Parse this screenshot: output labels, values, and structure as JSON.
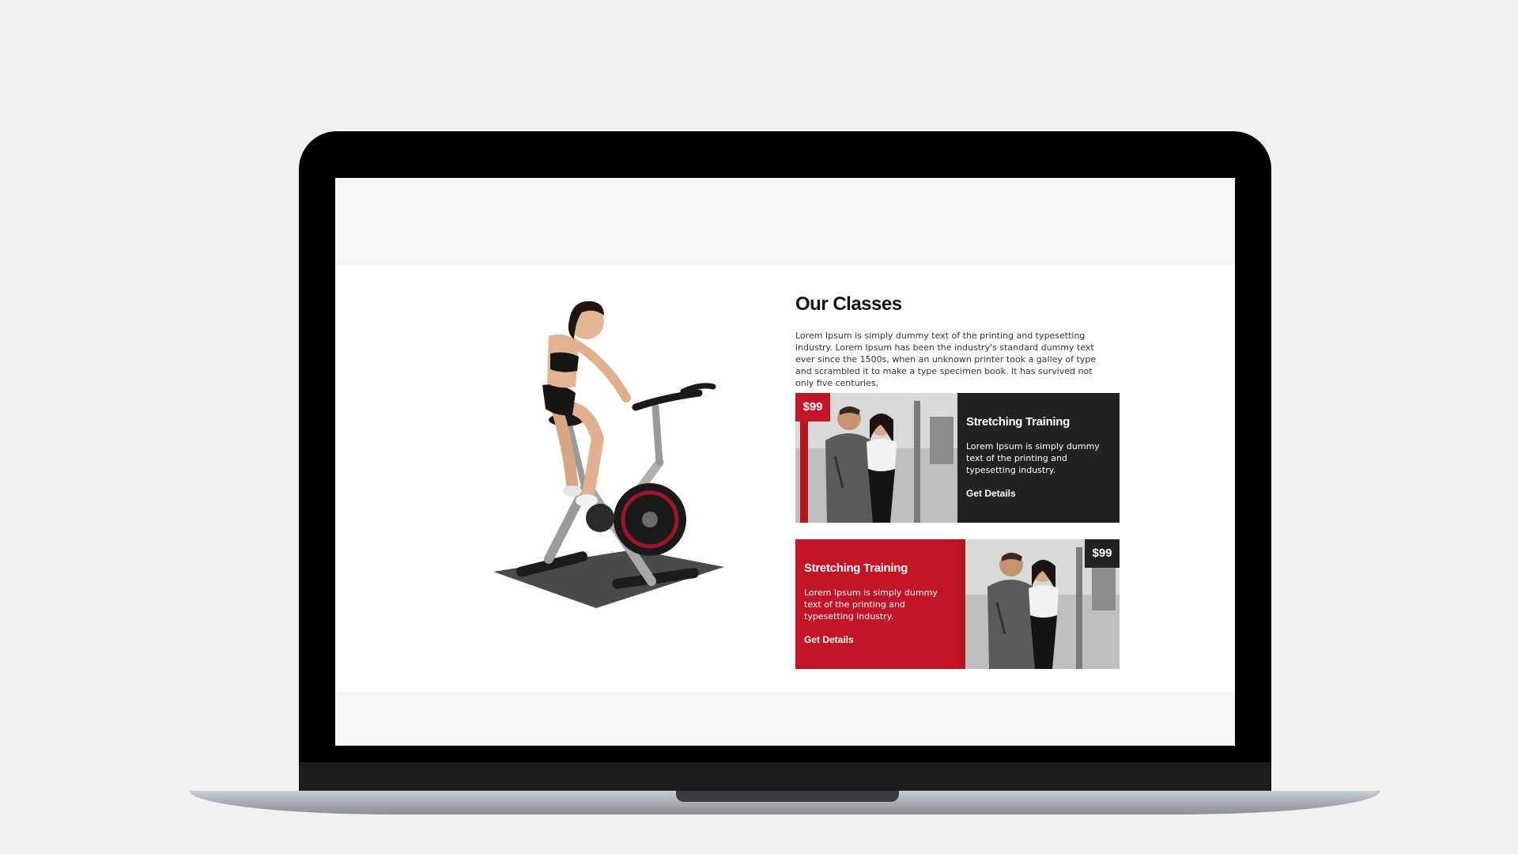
{
  "classes_section": {
    "title": "Our Classes",
    "description": "Lorem Ipsum is simply dummy text of the printing and typesetting industry. Lorem Ipsum has been the industry's standard dummy text ever since the 1500s, when an unknown printer took a galley of type and scrambled it to make a type specimen book. It has survived not only five centuries,"
  },
  "cards": [
    {
      "price": "$99",
      "title": "Stretching Training",
      "text": "Lorem Ipsum is simply dummy text of the printing and typesetting industry.",
      "link": "Get Details"
    },
    {
      "price": "$99",
      "title": "Stretching Training",
      "text": "Lorem Ipsum is simply dummy text of the printing and typesetting industry.",
      "link": "Get Details"
    }
  ],
  "colors": {
    "accent_red": "#c41526",
    "dark_panel": "#222222",
    "page_bg": "#f1f1ef"
  },
  "icons": {
    "bike_image": "woman-on-exercise-bike",
    "card_photo": "couple-training-in-gym"
  }
}
